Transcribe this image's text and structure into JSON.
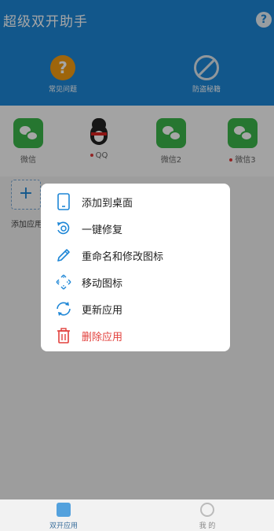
{
  "header": {
    "title": "超级双开助手",
    "help_glyph": "?",
    "features": [
      {
        "label": "常见问题",
        "icon": "question-icon",
        "glyph": "?"
      },
      {
        "label": "防盗秘籍",
        "icon": "no-entry-icon"
      }
    ],
    "accent": "#1d86d6"
  },
  "apps": [
    {
      "label": "微信",
      "icon": "wechat-icon",
      "dot": false
    },
    {
      "label": "QQ",
      "icon": "qq-icon",
      "dot": true
    },
    {
      "label": "微信2",
      "icon": "wechat-icon",
      "dot": false
    },
    {
      "label": "微信3",
      "icon": "wechat-icon",
      "dot": true
    }
  ],
  "add_app": {
    "label": "添加应用",
    "glyph": "+"
  },
  "menu": {
    "items": [
      {
        "label": "添加到桌面",
        "icon": "phone-icon"
      },
      {
        "label": "一键修复",
        "icon": "repair-icon"
      },
      {
        "label": "重命名和修改图标",
        "icon": "pencil-icon"
      },
      {
        "label": "移动图标",
        "icon": "move-icon"
      },
      {
        "label": "更新应用",
        "icon": "refresh-icon"
      },
      {
        "label": "删除应用",
        "icon": "trash-icon",
        "color": "#e2403c"
      }
    ]
  },
  "bottom_nav": {
    "items": [
      {
        "label": "双开应用",
        "active": true
      },
      {
        "label": "我 的",
        "active": false
      }
    ]
  }
}
